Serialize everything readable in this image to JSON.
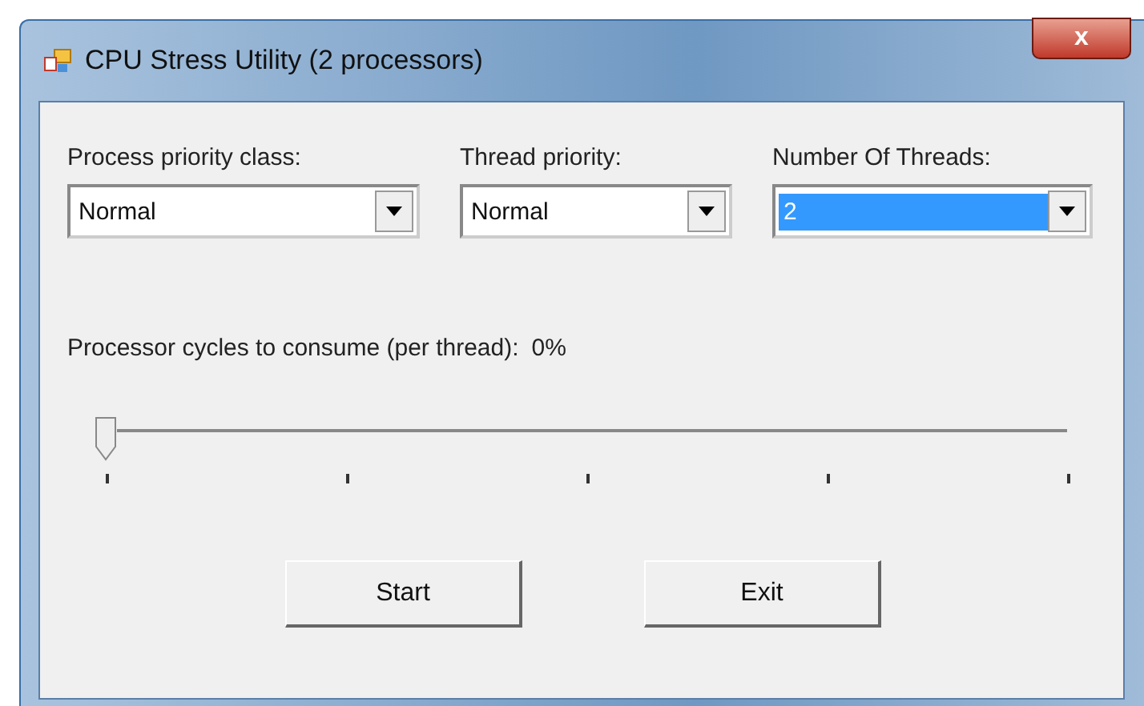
{
  "window": {
    "title": "CPU Stress Utility (2 processors)",
    "close": "x"
  },
  "dropdowns": [
    {
      "label": "Process priority class:",
      "value": "Normal",
      "focused": false
    },
    {
      "label": "Thread priority:",
      "value": "Normal",
      "focused": false
    },
    {
      "label": "Number Of Threads:",
      "value": "2",
      "focused": true
    }
  ],
  "slider": {
    "label": "Processor cycles to consume (per thread):",
    "reading": "0%",
    "level": 0
  },
  "buttons": [
    "Start",
    "Exit"
  ]
}
